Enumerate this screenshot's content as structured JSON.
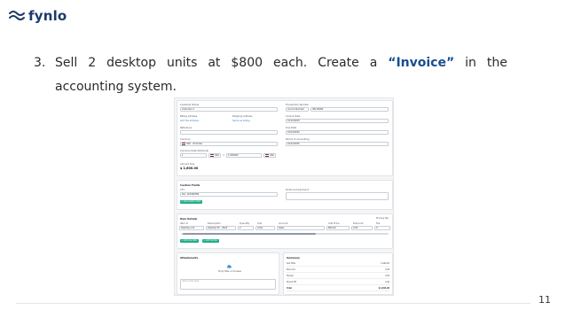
{
  "logo": {
    "name": "fynlo",
    "icon": "wave-logo-icon",
    "color": "#1b3a6b"
  },
  "task": {
    "number": "3.",
    "words": [
      "Sell",
      "2",
      "desktop",
      "units",
      "at",
      "$800",
      "each.",
      "Create",
      "a"
    ],
    "keyword": "“Invoice”",
    "words_after": [
      "in",
      "the"
    ],
    "line2": "accounting system.",
    "keyword_color": "#1a4e8e"
  },
  "page_number": "11",
  "screenshot": {
    "customer_name_label": "Customer Name",
    "customer_name_value": "Customer A",
    "billing_address_label": "Billing Address",
    "billing_address_value": "add the address",
    "shipping_address_label": "Shipping Address",
    "shipping_address_value": "Same as billing",
    "reference_label": "Reference",
    "currency_label": "Currency",
    "currency_value": "USD - US Dollar",
    "currency_rate_label": "Currency Rate (Optional)",
    "rate_from": "1",
    "rate_from_code": "USD",
    "rate_to": "1.000000",
    "rate_to_code": "USD",
    "amount_due_label": "Amount Due",
    "amount_due_value": "$ 1,600.00",
    "transaction_number_label": "Transaction Number",
    "transaction_number_value": "Invoice Number",
    "transaction_number_id": "INV-00002",
    "invoice_date_label": "Invoice Date",
    "invoice_date_value": "01/01/2025",
    "due_date_label": "Due Date",
    "due_date_value": "01/01/2025",
    "period_label": "Period of accounting",
    "period_value": "01/01/2025",
    "custom_fields_title": "Custom Fields",
    "cf_label": "CF1",
    "cf_value": "Tax: 123456789",
    "cf_button": "+ Add Custom Field",
    "terms_label": "Terms and payment",
    "item_details_title": "Item Details",
    "tax_toggle": "Pricing Tax",
    "item_columns": [
      "Item #",
      "Description",
      "Quantity",
      "Unit",
      "Account",
      "Unit Price",
      "Discount",
      "Tax"
    ],
    "item_row": [
      "Desktop unit",
      "Desktop PC - 2024",
      "2",
      "Units",
      "Sales",
      "800.00",
      "0.00",
      "0"
    ],
    "add_line_button": "+ Add Line Item",
    "add_section_button": "+ Add Section",
    "attachments_title": "Attachments",
    "upload_text": "Drop files or browse",
    "notes_placeholder": "Add a note here",
    "summary_title": "Summary",
    "summary_rows": [
      {
        "label": "Sub Total",
        "value": "1,600.00"
      },
      {
        "label": "Discount",
        "value": "0.00"
      },
      {
        "label": "Tax(es)",
        "value": "0.00"
      },
      {
        "label": "Round Off",
        "value": "0.00"
      },
      {
        "label": "Total",
        "value": "$1,600.00"
      }
    ],
    "accent": "#1fae8c"
  }
}
